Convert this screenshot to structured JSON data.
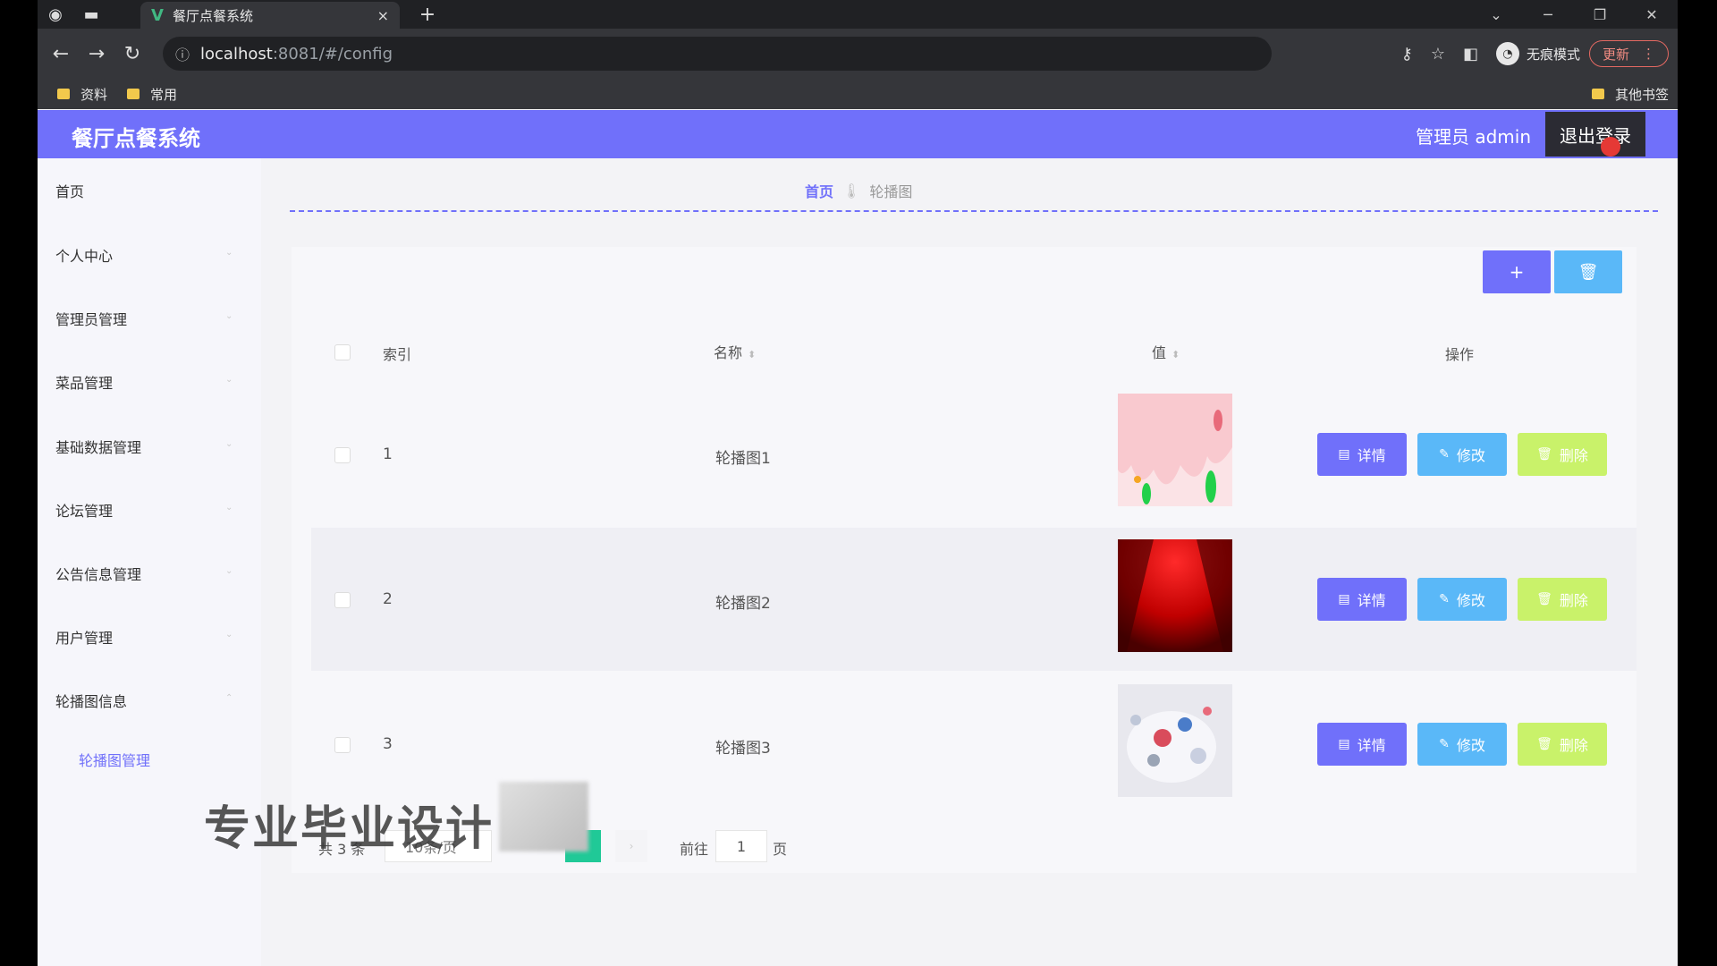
{
  "browser": {
    "tab_title": "餐厅点餐系统",
    "tab_close": "×",
    "new_tab": "+",
    "url_host": "localhost",
    "url_rest": ":8081/#/config",
    "incognito_label": "无痕模式",
    "update_label": "更新",
    "bookmarks": [
      "资料",
      "常用"
    ],
    "other_bookmarks": "其他书签"
  },
  "header": {
    "title": "餐厅点餐系统",
    "admin_label": "管理员 admin",
    "logout_label": "退出登录"
  },
  "sidebar": {
    "items": [
      "首页",
      "个人中心",
      "管理员管理",
      "菜品管理",
      "基础数据管理",
      "论坛管理",
      "公告信息管理",
      "用户管理",
      "轮播图信息"
    ],
    "sub_item": "轮播图管理"
  },
  "breadcrumb": {
    "home": "首页",
    "current": "轮播图"
  },
  "toolbar": {
    "add_label": "+",
    "delete_label": "🗑"
  },
  "table": {
    "headers": {
      "index": "索引",
      "name": "名称",
      "value": "值",
      "actions": "操作"
    },
    "rows": [
      {
        "index": "1",
        "name": "轮播图1"
      },
      {
        "index": "2",
        "name": "轮播图2"
      },
      {
        "index": "3",
        "name": "轮播图3"
      }
    ],
    "detail_label": "详情",
    "edit_label": "修改",
    "delete_label": "删除"
  },
  "pagination": {
    "total": "共 3 条",
    "page_size": "10条/页",
    "goto_prefix": "前往",
    "goto_value": "1",
    "goto_suffix": "页"
  },
  "watermark": "专业毕业设计"
}
